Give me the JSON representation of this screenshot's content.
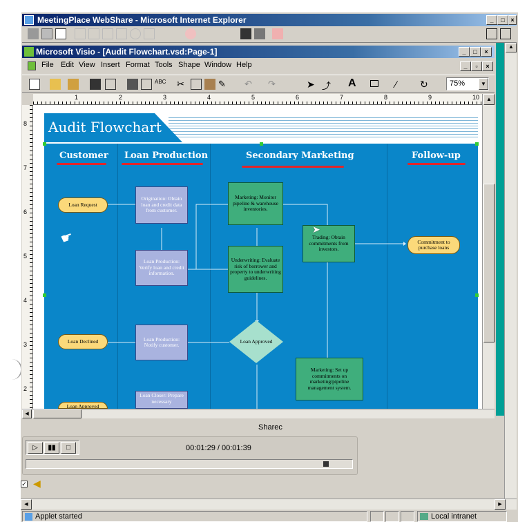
{
  "ie_window": {
    "title": "MeetingPlace WebShare - Microsoft Internet Explorer"
  },
  "visio_window": {
    "title": "Microsoft Visio - [Audit Flowchart.vsd:Page-1]"
  },
  "menu": {
    "items": [
      {
        "key": "file",
        "label": "File"
      },
      {
        "key": "edit",
        "label": "Edit"
      },
      {
        "key": "view",
        "label": "View"
      },
      {
        "key": "insert",
        "label": "Insert"
      },
      {
        "key": "format",
        "label": "Format"
      },
      {
        "key": "tools",
        "label": "Tools"
      },
      {
        "key": "shape",
        "label": "Shape"
      },
      {
        "key": "window",
        "label": "Window"
      },
      {
        "key": "help",
        "label": "Help"
      }
    ]
  },
  "toolbar": {
    "zoom": "75%"
  },
  "ruler": {
    "h_numbers": [
      "1",
      "2",
      "3",
      "4",
      "5",
      "6",
      "7",
      "8",
      "9",
      "10"
    ],
    "v_numbers": [
      "8",
      "7",
      "6",
      "5",
      "4",
      "3",
      "2"
    ]
  },
  "diagram": {
    "title": "Audit Flowchart",
    "lanes": [
      "Customer",
      "Loan Production",
      "Secondary Marketing",
      "Follow-up"
    ],
    "nodes": {
      "loan_request": "Loan Request",
      "origination": "Origination: Obtain loan and credit data from customer.",
      "marketing_monitor": "Marketing: Monitor pipeline & warehouse inventories.",
      "trading": "Trading: Obtain commitments from investors.",
      "commitment": "Commitment to purchase loans",
      "verify": "Loan Production: Verify loan and credit information.",
      "underwriting": "Underwriting: Evaluate risk of borrower and property to underwriting guidelines.",
      "loan_declined": "Loan Declined",
      "notify": "Loan Production: Notify customer.",
      "loan_approved_decision": "Loan Approved",
      "marketing_setup": "Marketing: Set up commitments on marketing/pipeline management system.",
      "loan_closer": "Loan Closer: Prepare necessary",
      "loan_approved_term": "Loan Approved"
    }
  },
  "media": {
    "panel_title": "Sharec",
    "time": "00:01:29 / 00:01:39",
    "progress_fraction": 0.93
  },
  "status": {
    "left": "Applet started",
    "zone": "Local intranet"
  },
  "colors": {
    "canvas_blue": "#0a86c9",
    "title_navy": "#0a246a",
    "teal": "#009f96"
  }
}
